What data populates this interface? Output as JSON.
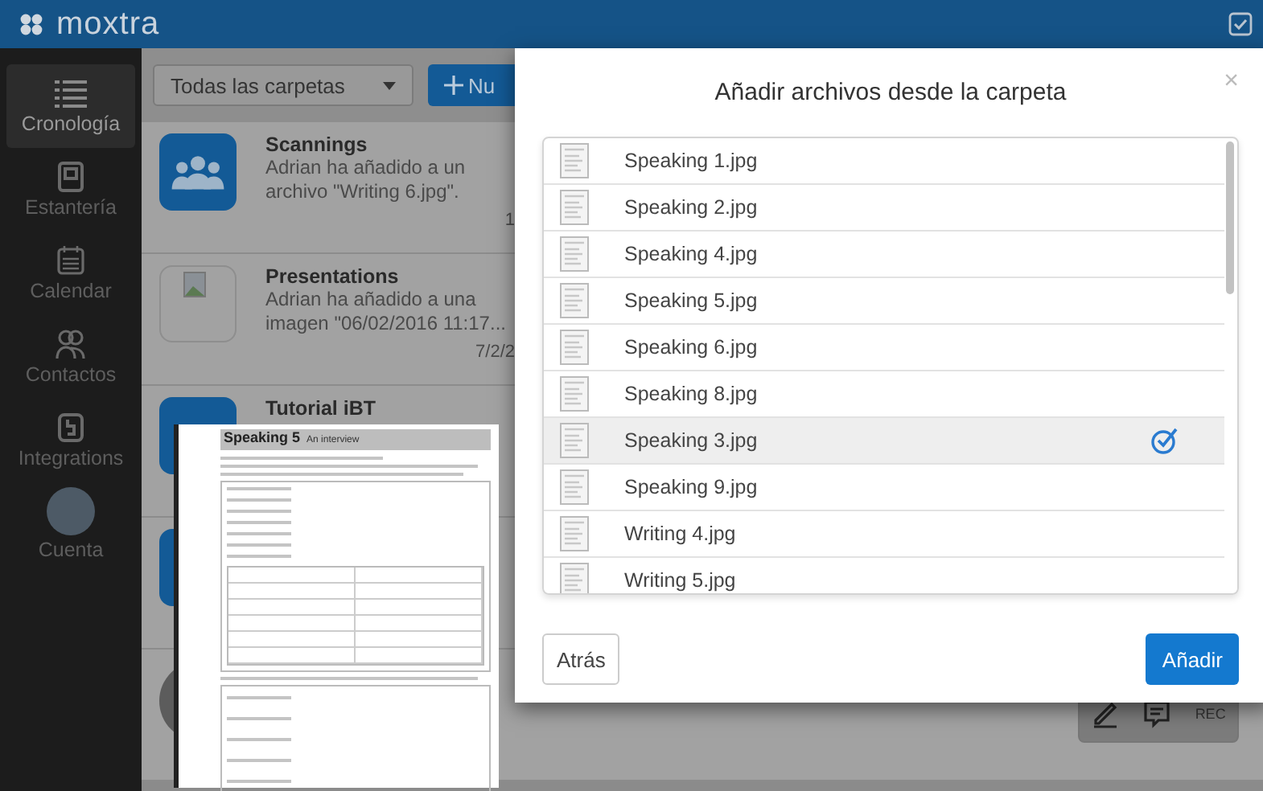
{
  "app": {
    "logo": "moxtra"
  },
  "sidebar": {
    "items": [
      {
        "label": "Cronología",
        "selected": true
      },
      {
        "label": "Estantería",
        "selected": false
      },
      {
        "label": "Calendar",
        "selected": false
      },
      {
        "label": "Contactos",
        "selected": false
      },
      {
        "label": "Integrations",
        "selected": false
      },
      {
        "label": "Cuenta",
        "selected": false
      }
    ]
  },
  "toolbar": {
    "folder_select": "Todas las carpetas",
    "new_button": "Nu"
  },
  "feed": [
    {
      "kind": "group",
      "title": "Scannings",
      "text": "Adrian ha añadido a un archivo \"Writing 6.jpg\".",
      "date": "1"
    },
    {
      "kind": "image",
      "title": "Presentations",
      "text": "Adrian ha añadido a una imagen \"06/02/2016 11:17...",
      "date": "7/2/2"
    },
    {
      "kind": "folder",
      "title": "Tutorial iBT"
    },
    {
      "kind": "folder"
    },
    {
      "kind": "person"
    }
  ],
  "bottom_toolbar": {
    "rec_label": "REC"
  },
  "modal": {
    "title": "Añadir archivos desde la carpeta",
    "close": "×",
    "files": [
      {
        "name": "Speaking 1.jpg",
        "selected": false
      },
      {
        "name": "Speaking 2.jpg",
        "selected": false
      },
      {
        "name": "Speaking 4.jpg",
        "selected": false
      },
      {
        "name": "Speaking 5.jpg",
        "selected": false
      },
      {
        "name": "Speaking 6.jpg",
        "selected": false
      },
      {
        "name": "Speaking 8.jpg",
        "selected": false
      },
      {
        "name": "Speaking 3.jpg",
        "selected": true
      },
      {
        "name": "Speaking 9.jpg",
        "selected": false
      },
      {
        "name": "Writing 4.jpg",
        "selected": false
      },
      {
        "name": "Writing 5.jpg",
        "selected": false
      }
    ],
    "back_button": "Atrás",
    "add_button": "Añadir"
  },
  "preview": {
    "title": "Speaking 5",
    "subtitle": "An interview"
  }
}
